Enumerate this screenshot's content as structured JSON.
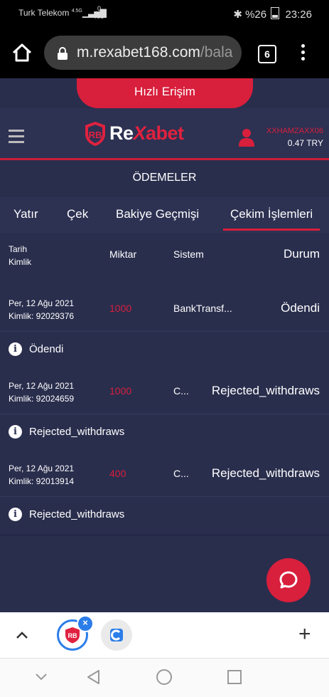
{
  "status_bar": {
    "carrier": "Turk Telekom",
    "signal_info": "4.5G",
    "speed_value": "0",
    "speed_unit": "K/s",
    "battery": "%26",
    "time": "23:26"
  },
  "browser": {
    "url_host": "m.rexabet168.com",
    "url_path": "/bala",
    "tab_count": "6"
  },
  "site": {
    "quick_access": "Hızlı Erişim",
    "logo_re": "Re",
    "logo_x": "X",
    "logo_abet": "abet",
    "username": "XXHAMZAXX06",
    "balance": "0.47 TRY",
    "page_title": "ÖDEMELER",
    "tabs": [
      {
        "label": "Yatır"
      },
      {
        "label": "Çek"
      },
      {
        "label": "Bakiye Geçmişi"
      },
      {
        "label": "Çekim İşlemleri"
      }
    ],
    "table_header": {
      "date": "Tarih",
      "id": "Kimlik",
      "amount": "Miktar",
      "system": "Sistem",
      "status": "Durum"
    },
    "rows": [
      {
        "date": "Per, 12 Ağu 2021",
        "id": "Kimlik: 92029376",
        "amount": "1000",
        "system": "BankTransf...",
        "status": "Ödendi",
        "info": "Ödendi"
      },
      {
        "date": "Per, 12 Ağu 2021",
        "id": "Kimlik: 92024659",
        "amount": "1000",
        "system": "C...",
        "status": "Rejected_withdraws",
        "info": "Rejected_withdraws"
      },
      {
        "date": "Per, 12 Ağu 2021",
        "id": "Kimlik: 92013914",
        "amount": "400",
        "system": "C...",
        "status": "Rejected_withdraws",
        "info": "Rejected_withdraws"
      }
    ]
  },
  "colors": {
    "brand_red": "#d81f3c",
    "background": "#2a2e4d",
    "tab_active_blue": "#2b7de9"
  }
}
